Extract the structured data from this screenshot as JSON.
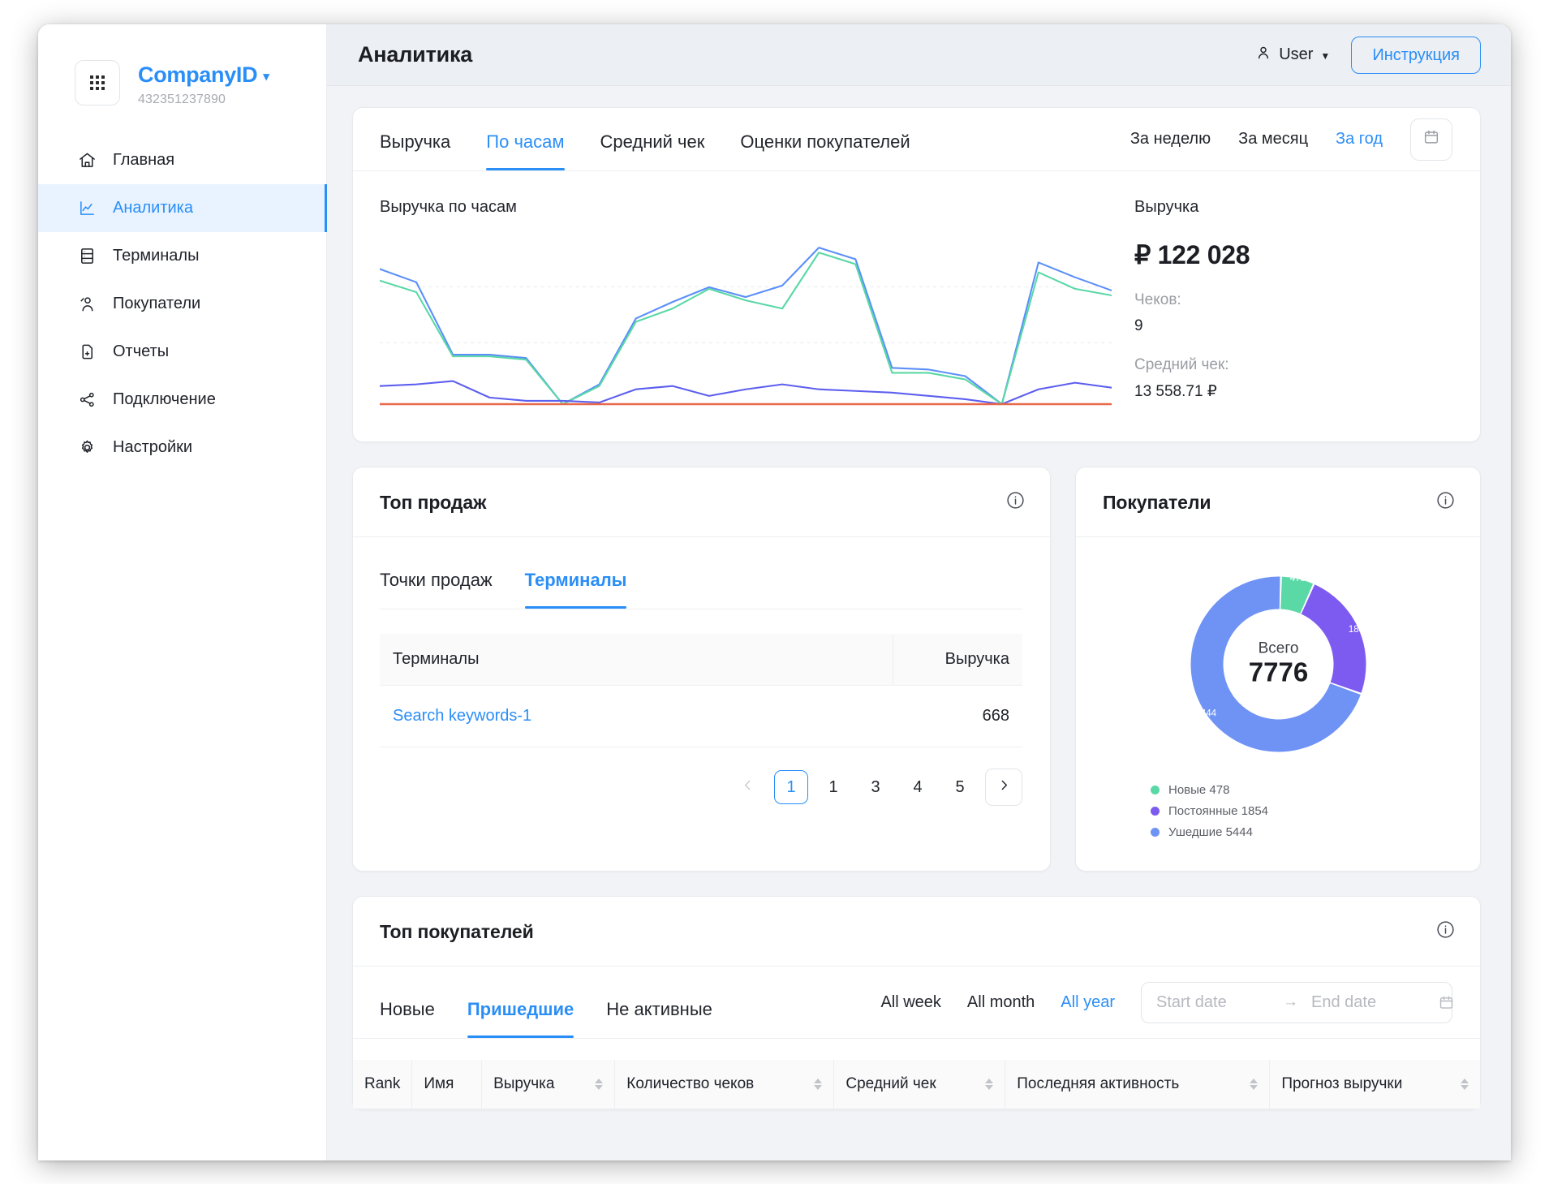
{
  "sidebar": {
    "company": {
      "name": "CompanyID",
      "id": "432351237890",
      "logo_icon": "grid-dots-icon",
      "caret_icon": "chevron-down-icon"
    },
    "items": [
      {
        "label": "Главная",
        "icon": "home-icon",
        "active": false
      },
      {
        "label": "Аналитика",
        "icon": "chart-line-icon",
        "active": true
      },
      {
        "label": "Терминалы",
        "icon": "server-icon",
        "active": false
      },
      {
        "label": "Покупатели",
        "icon": "users-icon",
        "active": false
      },
      {
        "label": "Отчеты",
        "icon": "document-icon",
        "active": false
      },
      {
        "label": "Подключение",
        "icon": "share-nodes-icon",
        "active": false
      },
      {
        "label": "Настройки",
        "icon": "gear-icon",
        "active": false
      }
    ]
  },
  "header": {
    "title": "Аналитика",
    "user_label": "User",
    "user_icon": "person-icon",
    "user_caret_icon": "caret-down-icon",
    "instruction_button": "Инструкция"
  },
  "analytics_card": {
    "tabs": [
      {
        "label": "Выручка",
        "active": false
      },
      {
        "label": "По часам",
        "active": true
      },
      {
        "label": "Средний чек",
        "active": false
      },
      {
        "label": "Оценки покупателей",
        "active": false
      }
    ],
    "periods": [
      {
        "label": "За неделю",
        "active": false
      },
      {
        "label": "За месяц",
        "active": false
      },
      {
        "label": "За год",
        "active": true
      }
    ],
    "calendar_icon": "calendar-icon",
    "chart_title": "Выручка по часам",
    "stats": {
      "label": "Выручка",
      "total": "₽ 122 028",
      "checks_label": "Чеков:",
      "checks_value": "9",
      "avg_label": "Средний чек:",
      "avg_value": "13 558.71 ₽"
    }
  },
  "sales_card": {
    "title": "Топ продаж",
    "info_icon": "info-circle-icon",
    "subtabs": [
      {
        "label": "Точки продаж",
        "active": false
      },
      {
        "label": "Терминалы",
        "active": true
      }
    ],
    "columns": [
      "Терминалы",
      "Выручка"
    ],
    "rows": [
      {
        "name": "Search keywords-1",
        "revenue": "668"
      }
    ],
    "pagination": {
      "prev_icon": "chevron-left-icon",
      "next_icon": "chevron-right-icon",
      "pages": [
        "1",
        "1",
        "3",
        "4",
        "5"
      ],
      "current_index": 0
    }
  },
  "buyers_card": {
    "title": "Покупатели",
    "info_icon": "info-circle-icon",
    "center_label": "Всего",
    "center_value": "7776"
  },
  "bottom_card": {
    "title": "Топ покупателей",
    "info_icon": "info-circle-icon",
    "tabs": [
      {
        "label": "Новые",
        "active": false
      },
      {
        "label": "Пришедшие",
        "active": true
      },
      {
        "label": "Не активные",
        "active": false
      }
    ],
    "periods": [
      {
        "label": "All week",
        "active": false
      },
      {
        "label": "All month",
        "active": false
      },
      {
        "label": "All year",
        "active": true
      }
    ],
    "date_range": {
      "start_placeholder": "Start date",
      "end_placeholder": "End date",
      "start_value": "",
      "end_value": "",
      "arrow": "→",
      "calendar_icon": "calendar-icon"
    },
    "columns": [
      {
        "label": "Rank",
        "sortable": false
      },
      {
        "label": "Имя",
        "sortable": false
      },
      {
        "label": "Выручка",
        "sortable": true
      },
      {
        "label": "Количество чеков",
        "sortable": true
      },
      {
        "label": "Средний чек",
        "sortable": true
      },
      {
        "label": "Последняя активность",
        "sortable": true
      },
      {
        "label": "Прогноз выручки",
        "sortable": true
      }
    ]
  },
  "colors": {
    "accent": "#2a8ef7",
    "series_blue": "#5b8ff9",
    "series_green": "#5ad8a6",
    "series_indigo": "#5d5fef",
    "series_red": "#e8684a",
    "donut_green": "#5ad8a6",
    "donut_purple": "#7d5bf0",
    "donut_blue": "#6f93f5"
  },
  "chart_data": [
    {
      "type": "line",
      "title": "Выручка по часам",
      "xlabel": "",
      "ylabel": "",
      "grid": true,
      "legend": "none",
      "x": [
        0,
        1,
        2,
        3,
        4,
        5,
        6,
        7,
        8,
        9,
        10,
        11,
        12,
        13,
        14,
        15,
        16,
        17,
        18,
        19,
        20
      ],
      "ylim": [
        0,
        100
      ],
      "series": [
        {
          "name": "series-blue",
          "color": "#5b8ff9",
          "values": [
            82,
            74,
            30,
            30,
            28,
            0,
            12,
            52,
            62,
            71,
            65,
            72,
            95,
            88,
            22,
            21,
            17,
            0,
            86,
            77,
            69
          ]
        },
        {
          "name": "series-green",
          "color": "#5ad8a6",
          "values": [
            75,
            68,
            29,
            29,
            27,
            0,
            11,
            50,
            58,
            70,
            63,
            58,
            92,
            85,
            19,
            19,
            15,
            0,
            80,
            70,
            66
          ]
        },
        {
          "name": "series-indigo",
          "color": "#5d5fef",
          "values": [
            11,
            12,
            14,
            4,
            2,
            2,
            1,
            9,
            11,
            5,
            9,
            12,
            9,
            8,
            7,
            5,
            3,
            0,
            9,
            13,
            10
          ]
        },
        {
          "name": "series-red",
          "color": "#e8684a",
          "values": [
            0,
            0,
            0,
            0,
            0,
            0,
            0,
            0,
            0,
            0,
            0,
            0,
            0,
            0,
            0,
            0,
            0,
            0,
            0,
            0,
            0
          ]
        }
      ]
    },
    {
      "type": "pie",
      "title": "Покупатели",
      "center_label": "Всего",
      "total": 7776,
      "labels": [
        "Новые",
        "Постоянные",
        "Ушедшие"
      ],
      "values": [
        478,
        1854,
        5444
      ],
      "colors": [
        "#5ad8a6",
        "#7d5bf0",
        "#6f93f5"
      ],
      "legend": "bottom-left",
      "legend_entries": [
        {
          "label": "Новые",
          "value": "478",
          "color": "#5ad8a6"
        },
        {
          "label": "Постоянные",
          "value": "1854",
          "color": "#7d5bf0"
        },
        {
          "label": "Ушедшие",
          "value": "5444",
          "color": "#6f93f5"
        }
      ]
    }
  ]
}
